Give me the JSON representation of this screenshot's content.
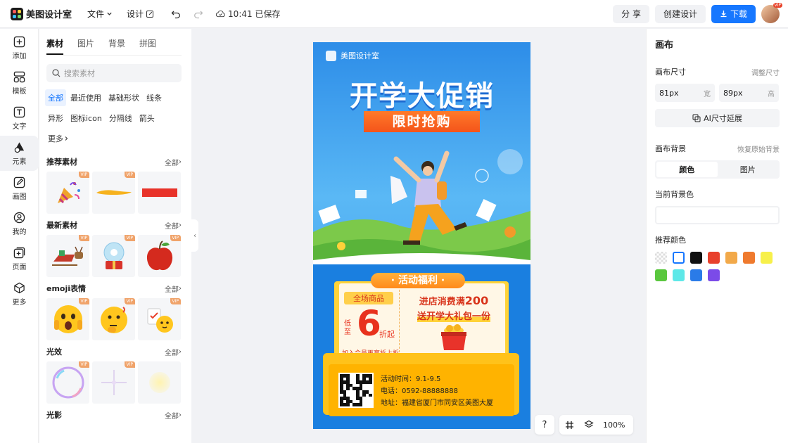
{
  "app": {
    "name": "美图设计室"
  },
  "menu": {
    "file": "文件",
    "design": "设计",
    "saved": "10:41 已保存"
  },
  "top_actions": {
    "share": "分 享",
    "create": "创建设计",
    "download": "下载",
    "avatar_badge": "VIP"
  },
  "left_nav": [
    {
      "label": "添加",
      "icon": "plus-square-icon"
    },
    {
      "label": "模板",
      "icon": "template-icon"
    },
    {
      "label": "文字",
      "icon": "text-icon"
    },
    {
      "label": "元素",
      "icon": "shapes-icon"
    },
    {
      "label": "画图",
      "icon": "pencil-icon"
    },
    {
      "label": "我的",
      "icon": "user-icon"
    },
    {
      "label": "页面",
      "icon": "page-add-icon"
    },
    {
      "label": "更多",
      "icon": "cube-icon"
    }
  ],
  "panel": {
    "tabs": [
      "素材",
      "图片",
      "背景",
      "拼图"
    ],
    "search_placeholder": "搜索素材",
    "chips": [
      "全部",
      "最近使用",
      "基础形状",
      "线条",
      "异形",
      "图标icon",
      "分隔线",
      "箭头",
      "更多"
    ],
    "all_label": "全部",
    "vip": "VIP",
    "sections": [
      "推荐素材",
      "最新素材",
      "emoji表情",
      "光效",
      "光影"
    ]
  },
  "poster": {
    "brand": "美图设计室",
    "title": "开学大促销",
    "ribbon": "限时抢购",
    "benefit_tag": "· 活动福利 ·",
    "pill": "全场商品",
    "di": "低至",
    "six": "6",
    "zhe": "折起",
    "join": "加入会员再享折上折",
    "r1_prefix": "进店消费满",
    "r1_num": "200",
    "r2": "送开学大礼包一份",
    "time": "活动时间：9.1-9.5",
    "phone": "电话：0592-88888888",
    "address": "地址：福建省厦门市同安区美图大厦"
  },
  "canvas_tools": {
    "help": "?",
    "zoom": "100%"
  },
  "right": {
    "title": "画布",
    "size_label": "画布尺寸",
    "size_link": "调整尺寸",
    "width_val": "81px",
    "width_unit": "宽",
    "height_val": "89px",
    "height_unit": "高",
    "ai_btn": "AI尺寸延展",
    "bg_label": "画布背景",
    "bg_link": "恢复原始背景",
    "seg_color": "颜色",
    "seg_image": "图片",
    "current_label": "当前背景色",
    "rec_label": "推荐颜色",
    "swatches": [
      "transparent",
      "#ffffff",
      "#111111",
      "#e8412c",
      "#f2a94a",
      "#ef7a2e",
      "#f7f04a",
      "#5ac73e",
      "#5ee8e8",
      "#2a7be8",
      "#7b4be8"
    ]
  }
}
